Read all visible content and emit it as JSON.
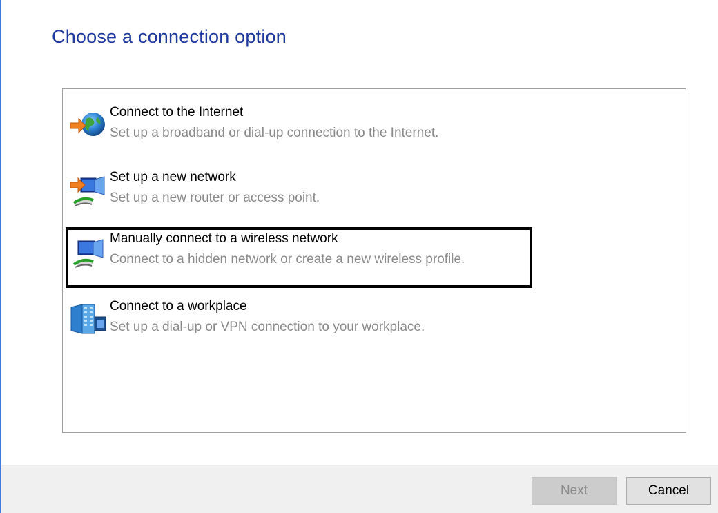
{
  "page": {
    "title": "Choose a connection option"
  },
  "options": [
    {
      "icon": "globe-arrow-icon",
      "title": "Connect to the Internet",
      "description": "Set up a broadband or dial-up connection to the Internet.",
      "selected": false
    },
    {
      "icon": "new-network-icon",
      "title": "Set up a new network",
      "description": "Set up a new router or access point.",
      "selected": false
    },
    {
      "icon": "wireless-network-icon",
      "title": "Manually connect to a wireless network",
      "description": "Connect to a hidden network or create a new wireless profile.",
      "selected": true
    },
    {
      "icon": "workplace-building-icon",
      "title": "Connect to a workplace",
      "description": "Set up a dial-up or VPN connection to your workplace.",
      "selected": false
    }
  ],
  "footer": {
    "next_label": "Next",
    "next_enabled": false,
    "cancel_label": "Cancel"
  },
  "colors": {
    "title": "#1e3a9e",
    "description": "#8a8a8a",
    "selection_border": "#000000",
    "footer_bg": "#f0f0f0"
  }
}
